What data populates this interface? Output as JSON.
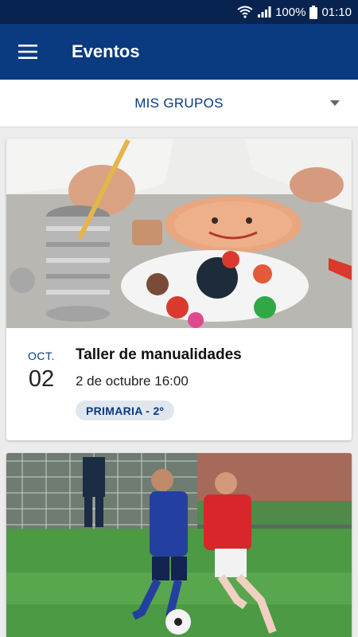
{
  "status_bar": {
    "battery_text": "100%",
    "time": "01:10",
    "icons": [
      "wifi-icon",
      "signal-icon",
      "battery-icon"
    ]
  },
  "app_bar": {
    "menu_icon": "hamburger-menu-icon",
    "title": "Eventos"
  },
  "group_selector": {
    "label": "MIS GRUPOS",
    "icon": "dropdown-arrow-icon"
  },
  "events": [
    {
      "image": "crafts-photo",
      "month": "OCT.",
      "day": "02",
      "title": "Taller de manualidades",
      "datetime": "2 de octubre 16:00",
      "tag": "PRIMARIA - 2º"
    },
    {
      "image": "soccer-photo"
    }
  ],
  "colors": {
    "status_bar": "#07234f",
    "app_bar": "#0a3a80",
    "accent": "#0a3a80",
    "tag_bg": "#e0e6ee",
    "background": "#ececec"
  }
}
